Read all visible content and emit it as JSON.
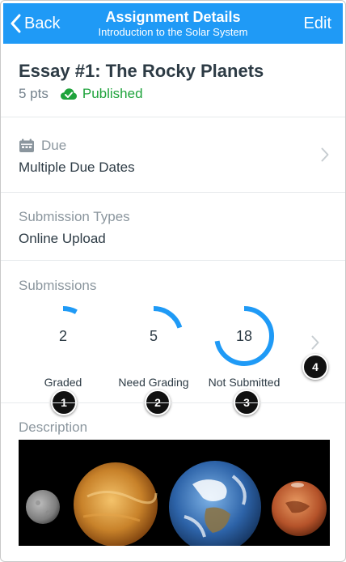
{
  "nav": {
    "back_label": "Back",
    "title": "Assignment Details",
    "subtitle": "Introduction to the Solar System",
    "edit_label": "Edit",
    "color": "#1f9af6"
  },
  "assignment": {
    "title": "Essay #1: The Rocky Planets",
    "points": "5 pts",
    "status": "Published",
    "status_color": "#1fa33c"
  },
  "due": {
    "label": "Due",
    "value": "Multiple Due Dates",
    "icon": "calendar-icon"
  },
  "submission_types": {
    "label": "Submission Types",
    "value": "Online Upload"
  },
  "submissions": {
    "label": "Submissions",
    "items": [
      {
        "count": "2",
        "label": "Graded",
        "fraction": 0.08,
        "marker": "1"
      },
      {
        "count": "5",
        "label": "Need Grading",
        "fraction": 0.2,
        "marker": "2"
      },
      {
        "count": "18",
        "label": "Not Submitted",
        "fraction": 0.72,
        "marker": "3"
      }
    ],
    "chevron_marker": "4",
    "ring_color": "#1f9af6"
  },
  "description": {
    "label": "Description",
    "image": "rocky-planets-image"
  }
}
